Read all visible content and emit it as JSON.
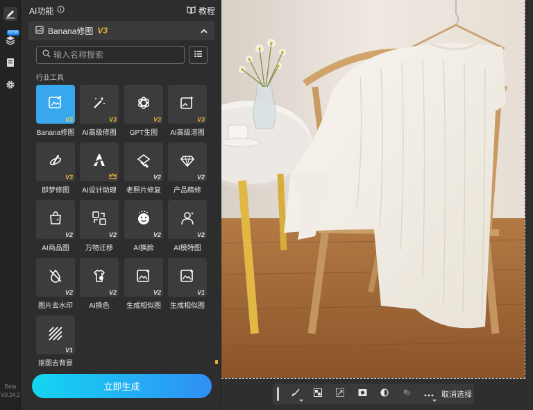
{
  "rail": {
    "new_badge": "NEW",
    "beta_label": "Beta",
    "version": "V0.24.2"
  },
  "panel": {
    "title": "AI功能",
    "tutorial": "教程",
    "sub_title": "Banana修图",
    "sub_version": "V3",
    "search_placeholder": "输入名称搜索",
    "section": "行业工具",
    "tools": [
      {
        "label": "Banana修图",
        "tag": "V3",
        "icon": "image-edit-icon"
      },
      {
        "label": "AI高级修图",
        "tag": "V3",
        "icon": "magic-wand-icon"
      },
      {
        "label": "GPT生图",
        "tag": "V3",
        "icon": "gpt-logo-icon"
      },
      {
        "label": "AI高级溶图",
        "tag": "V3",
        "icon": "image-sparkle-icon"
      },
      {
        "label": "即梦修图",
        "tag": "V3",
        "icon": "dream-brush-icon"
      },
      {
        "label": "AI设计助理",
        "tag": "",
        "icon": "design-assistant-icon"
      },
      {
        "label": "老照片修复",
        "tag": "V2",
        "icon": "photo-restore-icon"
      },
      {
        "label": "产品精修",
        "tag": "V2",
        "icon": "gem-icon"
      },
      {
        "label": "AI商品图",
        "tag": "V2",
        "icon": "shopping-bag-icon"
      },
      {
        "label": "万物迁移",
        "tag": "V2",
        "icon": "transfer-icon"
      },
      {
        "label": "AI换脸",
        "tag": "V2",
        "icon": "face-swap-icon"
      },
      {
        "label": "AI模特图",
        "tag": "V2",
        "icon": "model-icon"
      },
      {
        "label": "图片去水印",
        "tag": "V2",
        "icon": "remove-watermark-icon"
      },
      {
        "label": "AI换色",
        "tag": "V2",
        "icon": "recolor-icon"
      },
      {
        "label": "生成相似图",
        "tag": "V2",
        "icon": "similar-image-icon"
      },
      {
        "label": "生成相似图",
        "tag": "V1",
        "icon": "similar-image-icon"
      },
      {
        "label": "抠图去背景",
        "tag": "V1",
        "icon": "cutout-icon"
      }
    ],
    "generate_button": "立即生成"
  },
  "toolbar": {
    "cancel_label": "取消选择"
  },
  "colors": {
    "accent": "#39a7ee",
    "version_tag": "#e6b23a",
    "gradient_start": "#14d6f0",
    "gradient_end": "#2f8ff5"
  }
}
